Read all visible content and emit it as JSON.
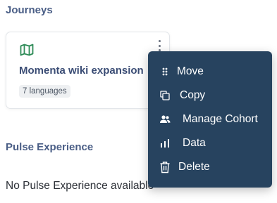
{
  "journeys": {
    "title": "Journeys",
    "card": {
      "icon": "map-icon",
      "title": "Momenta wiki expansion",
      "badge": "7 languages"
    }
  },
  "pulse": {
    "title": "Pulse Experience",
    "empty_text": "No Pulse Experience available"
  },
  "context_menu": {
    "items": [
      {
        "label": "Move",
        "icon": "drag-handle-icon"
      },
      {
        "label": "Copy",
        "icon": "copy-icon"
      },
      {
        "label": "Manage Cohort",
        "icon": "users-icon"
      },
      {
        "label": "Data",
        "icon": "bar-chart-icon"
      },
      {
        "label": "Delete",
        "icon": "trash-icon"
      }
    ]
  },
  "colors": {
    "section_title": "#4a5e86",
    "card_title": "#3b4d75",
    "map_icon": "#2e8b57",
    "menu_bg": "#27435f",
    "menu_text": "#ffffff"
  }
}
